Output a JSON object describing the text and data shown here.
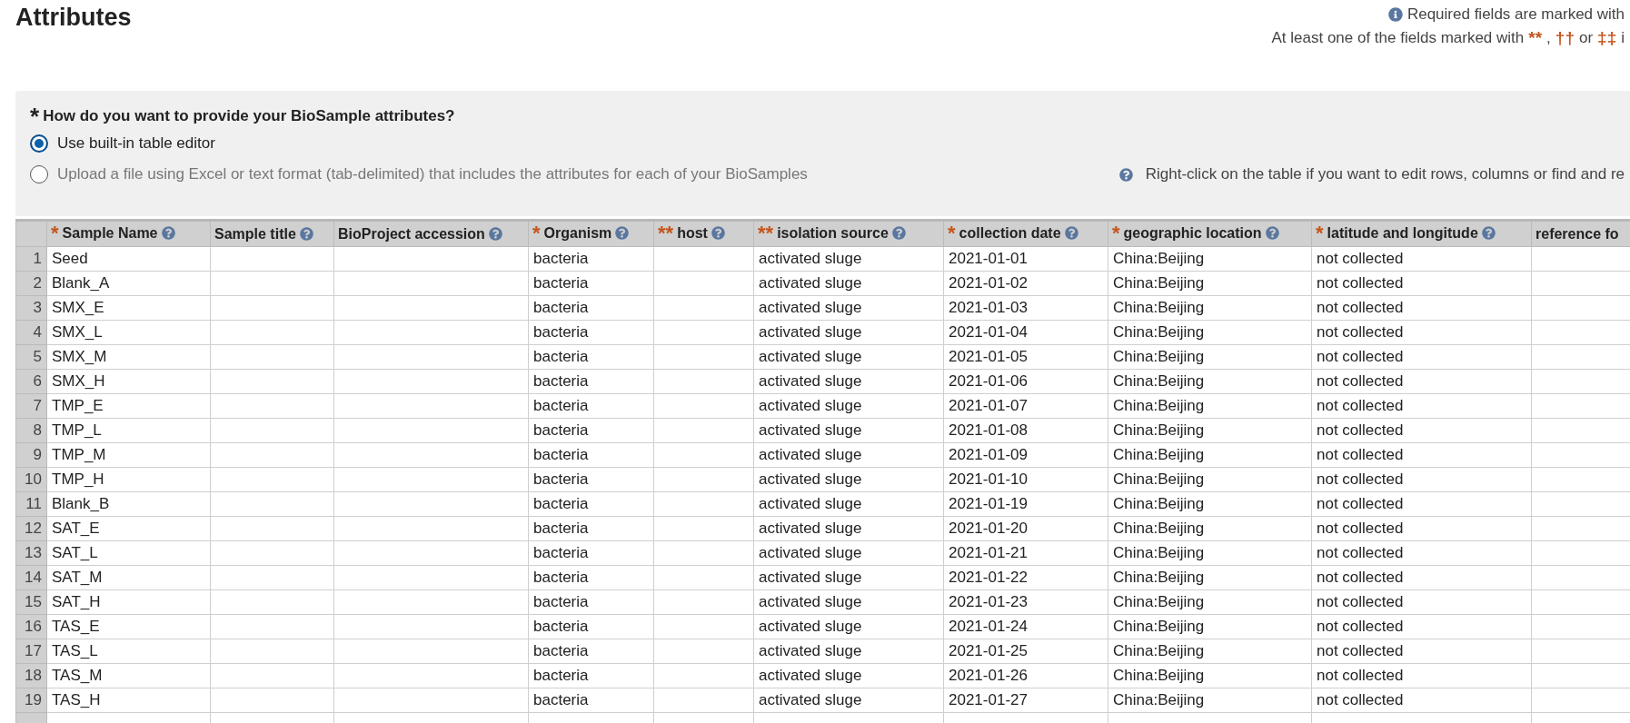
{
  "title": "Attributes",
  "notes": [
    [
      {
        "kind": "icon"
      },
      {
        "kind": "plain",
        "text": "Required fields are marked with"
      }
    ],
    [
      {
        "kind": "plain",
        "text": "At least one of the fields marked with"
      },
      {
        "kind": "mark",
        "text": "**"
      },
      {
        "kind": "plain",
        "text": ","
      },
      {
        "kind": "mark",
        "text": "††"
      },
      {
        "kind": "plain",
        "text": "or"
      },
      {
        "kind": "mark",
        "text": "‡‡"
      },
      {
        "kind": "plain",
        "text": "i"
      }
    ]
  ],
  "panel": {
    "question_mark": "*",
    "question": "How do you want to provide your BioSample attributes?",
    "options": [
      {
        "label": "Use built-in table editor",
        "selected": true
      },
      {
        "label": "Upload a file using Excel or text format (tab-delimited) that includes the attributes for each of your BioSamples",
        "selected": false
      }
    ],
    "hint": "Right-click on the table if you want to edit rows, columns or find and re"
  },
  "table": {
    "columns": [
      {
        "label": "Sample Name",
        "marker": "*",
        "help": true
      },
      {
        "label": "Sample title",
        "help": true
      },
      {
        "label": "BioProject accession",
        "help": true
      },
      {
        "label": "Organism",
        "marker": "*",
        "help": true
      },
      {
        "label": "host",
        "marker": "**",
        "help": true
      },
      {
        "label": "isolation source",
        "marker": "**",
        "help": true
      },
      {
        "label": "collection date",
        "marker": "*",
        "help": true
      },
      {
        "label": "geographic location",
        "marker": "*",
        "help": true
      },
      {
        "label": "latitude and longitude",
        "marker": "*",
        "help": true
      },
      {
        "label": "reference fo",
        "help": false
      }
    ],
    "rows": [
      {
        "number": "1",
        "cells": [
          "Seed",
          null,
          null,
          "bacteria",
          null,
          "activated sluge",
          "2021-01-01",
          "China:Beijing",
          "not collected",
          null
        ]
      },
      {
        "number": "2",
        "cells": [
          "Blank_A",
          null,
          null,
          "bacteria",
          null,
          "activated sluge",
          "2021-01-02",
          "China:Beijing",
          "not collected",
          null
        ]
      },
      {
        "number": "3",
        "cells": [
          "SMX_E",
          null,
          null,
          "bacteria",
          null,
          "activated sluge",
          "2021-01-03",
          "China:Beijing",
          "not collected",
          null
        ]
      },
      {
        "number": "4",
        "cells": [
          "SMX_L",
          null,
          null,
          "bacteria",
          null,
          "activated sluge",
          "2021-01-04",
          "China:Beijing",
          "not collected",
          null
        ]
      },
      {
        "number": "5",
        "cells": [
          "SMX_M",
          null,
          null,
          "bacteria",
          null,
          "activated sluge",
          "2021-01-05",
          "China:Beijing",
          "not collected",
          null
        ]
      },
      {
        "number": "6",
        "cells": [
          "SMX_H",
          null,
          null,
          "bacteria",
          null,
          "activated sluge",
          "2021-01-06",
          "China:Beijing",
          "not collected",
          null
        ]
      },
      {
        "number": "7",
        "cells": [
          "TMP_E",
          null,
          null,
          "bacteria",
          null,
          "activated sluge",
          "2021-01-07",
          "China:Beijing",
          "not collected",
          null
        ]
      },
      {
        "number": "8",
        "cells": [
          "TMP_L",
          null,
          null,
          "bacteria",
          null,
          "activated sluge",
          "2021-01-08",
          "China:Beijing",
          "not collected",
          null
        ]
      },
      {
        "number": "9",
        "cells": [
          "TMP_M",
          null,
          null,
          "bacteria",
          null,
          "activated sluge",
          "2021-01-09",
          "China:Beijing",
          "not collected",
          null
        ]
      },
      {
        "number": "10",
        "cells": [
          "TMP_H",
          null,
          null,
          "bacteria",
          null,
          "activated sluge",
          "2021-01-10",
          "China:Beijing",
          "not collected",
          null
        ]
      },
      {
        "number": "11",
        "cells": [
          "Blank_B",
          null,
          null,
          "bacteria",
          null,
          "activated sluge",
          "2021-01-19",
          "China:Beijing",
          "not collected",
          null
        ]
      },
      {
        "number": "12",
        "cells": [
          "SAT_E",
          null,
          null,
          "bacteria",
          null,
          "activated sluge",
          "2021-01-20",
          "China:Beijing",
          "not collected",
          null
        ]
      },
      {
        "number": "13",
        "cells": [
          "SAT_L",
          null,
          null,
          "bacteria",
          null,
          "activated sluge",
          "2021-01-21",
          "China:Beijing",
          "not collected",
          null
        ]
      },
      {
        "number": "14",
        "cells": [
          "SAT_M",
          null,
          null,
          "bacteria",
          null,
          "activated sluge",
          "2021-01-22",
          "China:Beijing",
          "not collected",
          null
        ]
      },
      {
        "number": "15",
        "cells": [
          "SAT_H",
          null,
          null,
          "bacteria",
          null,
          "activated sluge",
          "2021-01-23",
          "China:Beijing",
          "not collected",
          null
        ]
      },
      {
        "number": "16",
        "cells": [
          "TAS_E",
          null,
          null,
          "bacteria",
          null,
          "activated sluge",
          "2021-01-24",
          "China:Beijing",
          "not collected",
          null
        ]
      },
      {
        "number": "17",
        "cells": [
          "TAS_L",
          null,
          null,
          "bacteria",
          null,
          "activated sluge",
          "2021-01-25",
          "China:Beijing",
          "not collected",
          null
        ]
      },
      {
        "number": "18",
        "cells": [
          "TAS_M",
          null,
          null,
          "bacteria",
          null,
          "activated sluge",
          "2021-01-26",
          "China:Beijing",
          "not collected",
          null
        ]
      },
      {
        "number": "19",
        "cells": [
          "TAS_H",
          null,
          null,
          "bacteria",
          null,
          "activated sluge",
          "2021-01-27",
          "China:Beijing",
          "not collected",
          null
        ]
      }
    ]
  }
}
